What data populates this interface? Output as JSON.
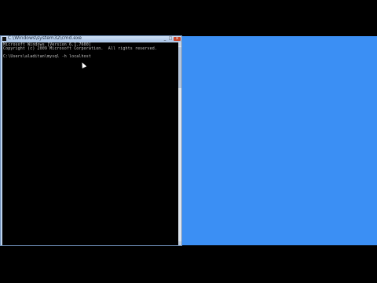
{
  "window": {
    "title": "C:\\Windows\\system32\\cmd.exe",
    "minimize": "_",
    "maximize": "□",
    "close": "x"
  },
  "console": {
    "lines": [
      "Microsoft Windows [Version 6.1.7600]",
      "Copyright (c) 2009 Microsoft Corporation.  All rights reserved.",
      "C:\\Users\\aladitan\\mysql -h localhost"
    ]
  },
  "colors": {
    "desktop": "#3b8ff4",
    "console_bg": "#000000",
    "console_text": "#c0c0c0"
  }
}
